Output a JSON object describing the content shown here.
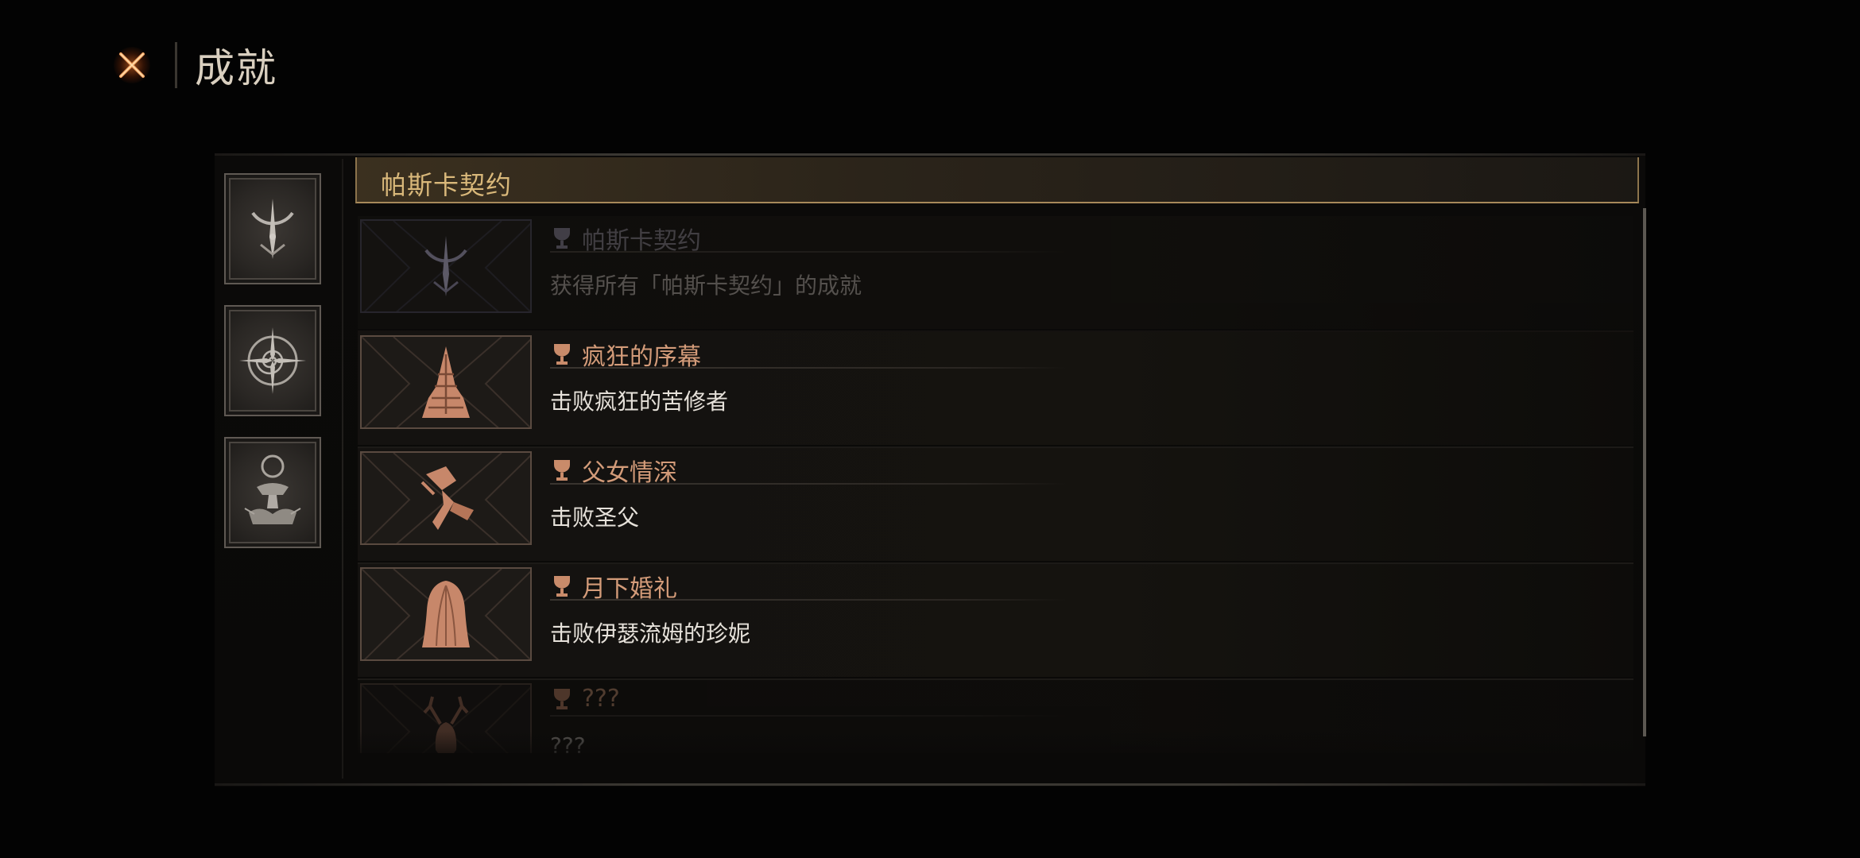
{
  "header": {
    "close_icon": "close-x-icon",
    "title": "成就"
  },
  "categories": [
    {
      "icon": "pascal-covenant-crest-icon",
      "selected": true
    },
    {
      "icon": "compass-spiral-icon",
      "selected": false
    },
    {
      "icon": "ritual-altar-icon",
      "selected": false
    }
  ],
  "section": {
    "title": "帕斯卡契约"
  },
  "achievements": [
    {
      "title": "帕斯卡契约",
      "description": "获得所有「帕斯卡契约」的成就",
      "icon": "pascal-covenant-crest-icon",
      "state": "locked"
    },
    {
      "title": "疯狂的序幕",
      "description": "击败疯狂的苦修者",
      "icon": "spiked-tower-icon",
      "state": "unlocked"
    },
    {
      "title": "父女情深",
      "description": "击败圣父",
      "icon": "broken-hammer-icon",
      "state": "unlocked"
    },
    {
      "title": "月下婚礼",
      "description": "击败伊瑟流姆的珍妮",
      "icon": "veiled-bride-icon",
      "state": "unlocked"
    },
    {
      "title": "???",
      "description": "???",
      "icon": "antlered-beast-icon",
      "state": "hidden"
    }
  ],
  "colors": {
    "accent_gold": "#d9b87a",
    "unlocked_title": "#d39b79",
    "locked_title": "#6e6a72",
    "close_glow": "#ff7a2a"
  }
}
